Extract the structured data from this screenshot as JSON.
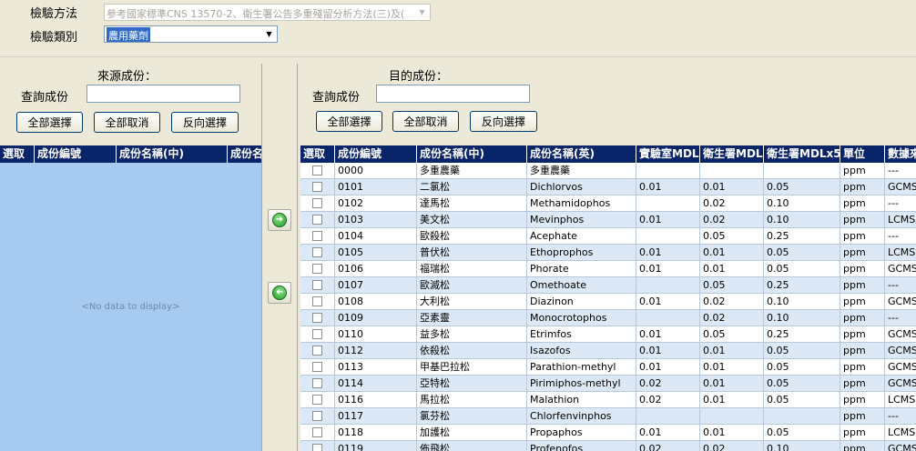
{
  "form": {
    "method_label": "檢驗方法",
    "method_value": "參考國家標準CNS 13570-2、衛生署公告多重殘留分析方法(三)及(",
    "category_label": "檢驗類別",
    "category_value": "農用藥劑"
  },
  "source": {
    "title": "來源成份：",
    "search_label": "查詢成份",
    "search_value": "",
    "btn_select_all": "全部選擇",
    "btn_clear_all": "全部取消",
    "btn_invert": "反向選擇",
    "columns": [
      "選取",
      "成份編號",
      "成份名稱(中)",
      "成份名"
    ],
    "empty_text": "<No data to display>"
  },
  "target": {
    "title": "目的成份：",
    "search_label": "查詢成份",
    "search_value": "",
    "btn_select_all": "全部選擇",
    "btn_clear_all": "全部取消",
    "btn_invert": "反向選擇",
    "columns": [
      "選取",
      "成份編號",
      "成份名稱(中)",
      "成份名稱(英)",
      "實驗室MDL",
      "衛生署MDL",
      "衛生署MDLx5",
      "單位",
      "數據來"
    ],
    "rows": [
      {
        "code": "0000",
        "zh": "多重農藥",
        "en": "多重農藥",
        "lab": "",
        "doh": "",
        "doh5": "",
        "unit": "ppm",
        "src": "---"
      },
      {
        "code": "0101",
        "zh": "二氯松",
        "en": "Dichlorvos",
        "lab": "0.01",
        "doh": "0.01",
        "doh5": "0.05",
        "unit": "ppm",
        "src": "GCMS"
      },
      {
        "code": "0102",
        "zh": "達馬松",
        "en": "Methamidophos",
        "lab": "",
        "doh": "0.02",
        "doh5": "0.10",
        "unit": "ppm",
        "src": "---"
      },
      {
        "code": "0103",
        "zh": "美文松",
        "en": "Mevinphos",
        "lab": "0.01",
        "doh": "0.02",
        "doh5": "0.10",
        "unit": "ppm",
        "src": "LCMS"
      },
      {
        "code": "0104",
        "zh": "歐殺松",
        "en": "Acephate",
        "lab": "",
        "doh": "0.05",
        "doh5": "0.25",
        "unit": "ppm",
        "src": "---"
      },
      {
        "code": "0105",
        "zh": "普伏松",
        "en": "Ethoprophos",
        "lab": "0.01",
        "doh": "0.01",
        "doh5": "0.05",
        "unit": "ppm",
        "src": "LCMS"
      },
      {
        "code": "0106",
        "zh": "福瑞松",
        "en": "Phorate",
        "lab": "0.01",
        "doh": "0.01",
        "doh5": "0.05",
        "unit": "ppm",
        "src": "GCMS"
      },
      {
        "code": "0107",
        "zh": "歐滅松",
        "en": "Omethoate",
        "lab": "",
        "doh": "0.05",
        "doh5": "0.25",
        "unit": "ppm",
        "src": "---"
      },
      {
        "code": "0108",
        "zh": "大利松",
        "en": "Diazinon",
        "lab": "0.01",
        "doh": "0.02",
        "doh5": "0.10",
        "unit": "ppm",
        "src": "GCMS"
      },
      {
        "code": "0109",
        "zh": "亞素靈",
        "en": "Monocrotophos",
        "lab": "",
        "doh": "0.02",
        "doh5": "0.10",
        "unit": "ppm",
        "src": "---"
      },
      {
        "code": "0110",
        "zh": "益多松",
        "en": "Etrimfos",
        "lab": "0.01",
        "doh": "0.05",
        "doh5": "0.25",
        "unit": "ppm",
        "src": "GCMS"
      },
      {
        "code": "0112",
        "zh": "依殺松",
        "en": "Isazofos",
        "lab": "0.01",
        "doh": "0.01",
        "doh5": "0.05",
        "unit": "ppm",
        "src": "GCMS"
      },
      {
        "code": "0113",
        "zh": "甲基巴拉松",
        "en": "Parathion-methyl",
        "lab": "0.01",
        "doh": "0.01",
        "doh5": "0.05",
        "unit": "ppm",
        "src": "GCMS"
      },
      {
        "code": "0114",
        "zh": "亞特松",
        "en": "Pirimiphos-methyl",
        "lab": "0.02",
        "doh": "0.01",
        "doh5": "0.05",
        "unit": "ppm",
        "src": "GCMS"
      },
      {
        "code": "0116",
        "zh": "馬拉松",
        "en": "Malathion",
        "lab": "0.02",
        "doh": "0.01",
        "doh5": "0.05",
        "unit": "ppm",
        "src": "LCMS"
      },
      {
        "code": "0117",
        "zh": "氯芬松",
        "en": "Chlorfenvinphos",
        "lab": "",
        "doh": "",
        "doh5": "",
        "unit": "ppm",
        "src": "---"
      },
      {
        "code": "0118",
        "zh": "加護松",
        "en": "Propaphos",
        "lab": "0.01",
        "doh": "0.01",
        "doh5": "0.05",
        "unit": "ppm",
        "src": "LCMS,"
      },
      {
        "code": "0119",
        "zh": "佈飛松",
        "en": "Profenofos",
        "lab": "0.02",
        "doh": "0.02",
        "doh5": "0.10",
        "unit": "ppm",
        "src": "GCMS"
      }
    ]
  },
  "icons": {
    "move_right": "arrow-right-icon",
    "move_left": "arrow-left-icon",
    "dropdown": "chevron-down-icon"
  },
  "colors": {
    "grid_header": "#0a246a",
    "source_grid_bg": "#a6caf0",
    "alt_row": "#dce8f5",
    "arrow_green": "#1f9b1f"
  }
}
